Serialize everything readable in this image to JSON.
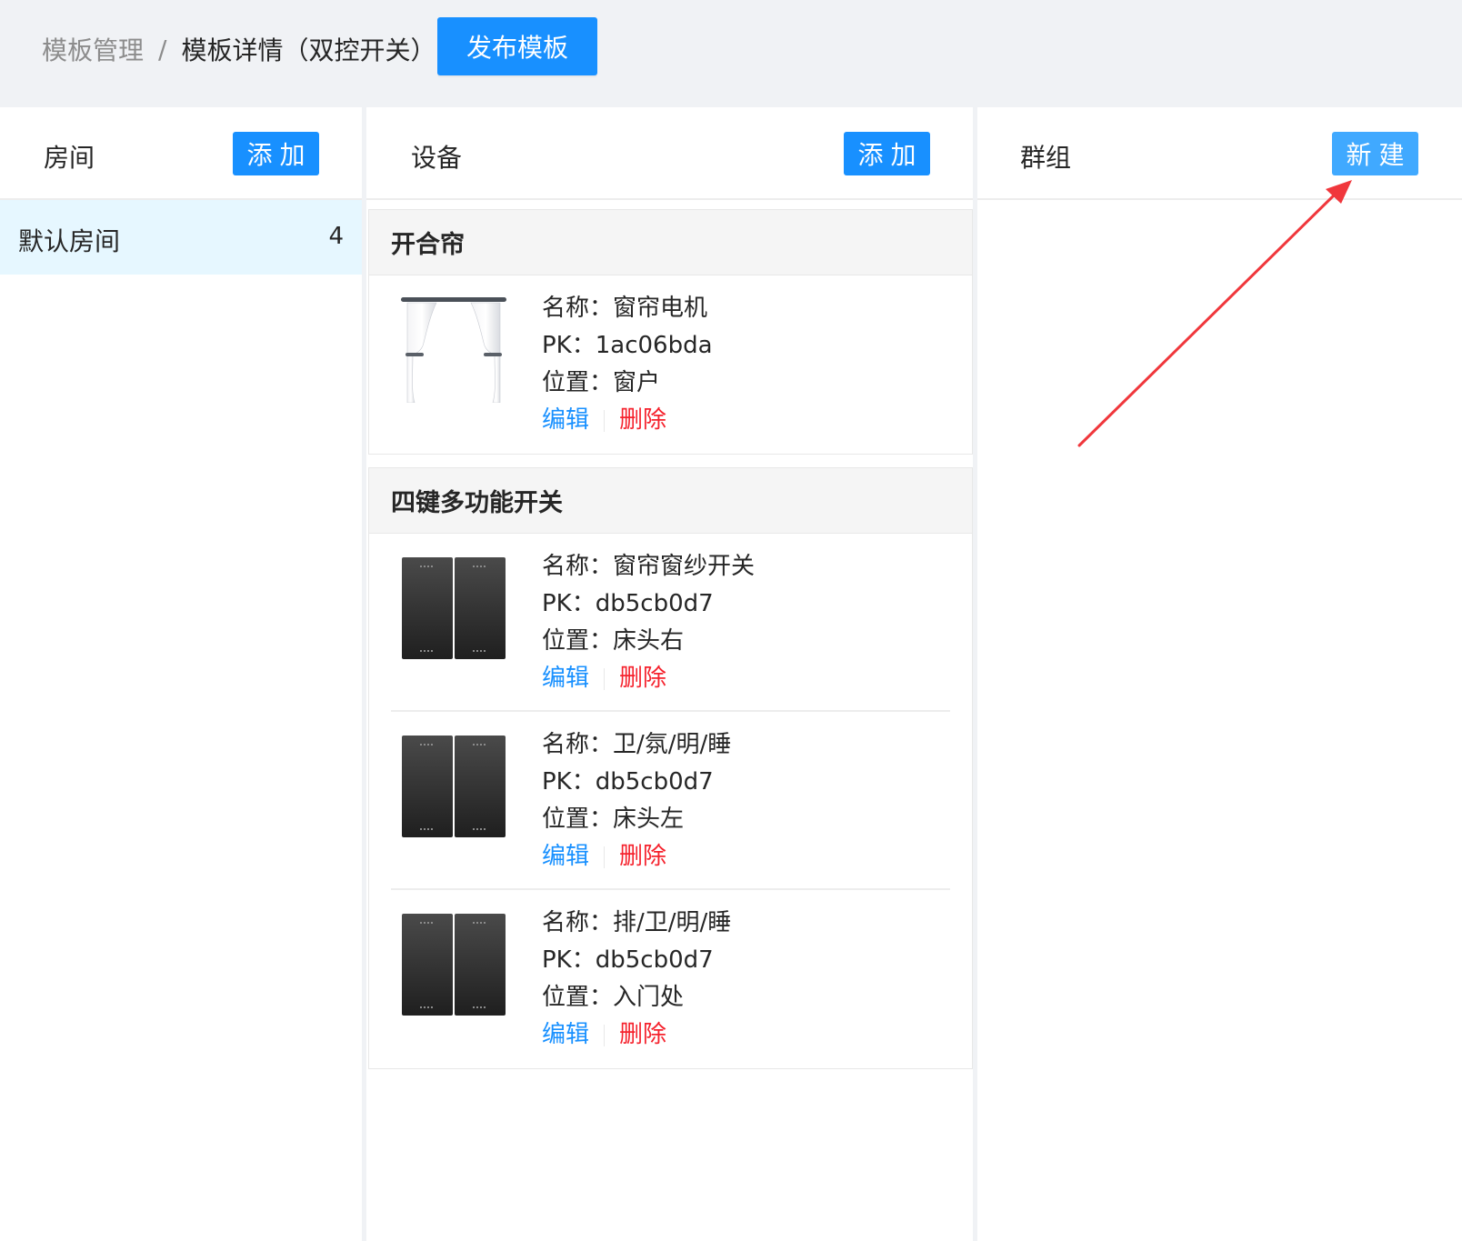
{
  "breadcrumb": {
    "parent": "模板管理",
    "separator": "/",
    "current": "模板详情（双控开关）"
  },
  "publish_button": "发布模板",
  "rooms_panel": {
    "title": "房间",
    "add_label": "添加",
    "items": [
      {
        "name": "默认房间",
        "count": "4"
      }
    ]
  },
  "devices_panel": {
    "title": "设备",
    "add_label": "添加",
    "groups": [
      {
        "name": "开合帘",
        "icon": "curtain-icon",
        "devices": [
          {
            "name_line": "名称：窗帘电机",
            "pk_line": "PK：1ac06bda",
            "position_line": "位置：窗户"
          }
        ]
      },
      {
        "name": "四键多功能开关",
        "icon": "switch-panel-icon",
        "devices": [
          {
            "name_line": "名称：窗帘窗纱开关",
            "pk_line": "PK：db5cb0d7",
            "position_line": "位置：床头右"
          },
          {
            "name_line": "名称：卫/氛/明/睡",
            "pk_line": "PK：db5cb0d7",
            "position_line": "位置：床头左"
          },
          {
            "name_line": "名称：排/卫/明/睡",
            "pk_line": "PK：db5cb0d7",
            "position_line": "位置：入门处"
          }
        ]
      }
    ],
    "edit_label": "编辑",
    "delete_label": "删除"
  },
  "groups_panel": {
    "title": "群组",
    "new_label": "新建"
  },
  "colors": {
    "primary": "#1890ff",
    "danger": "#f5222d",
    "selected_bg": "#e6f7ff",
    "annotation_arrow": "#f0373c"
  }
}
